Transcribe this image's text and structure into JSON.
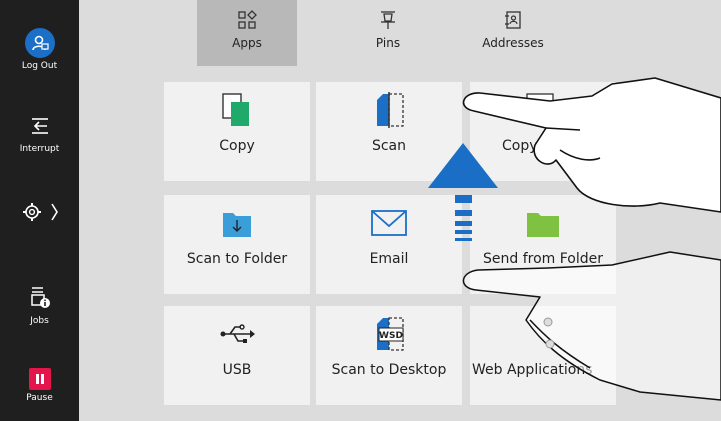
{
  "sidebar": {
    "logout_label": "Log Out",
    "interrupt_label": "Interrupt",
    "jobs_label": "Jobs",
    "pause_label": "Pause"
  },
  "tabs": [
    {
      "label": "Apps",
      "icon": "apps-icon"
    },
    {
      "label": "Pins",
      "icon": "pin-icon"
    },
    {
      "label": "Addresses",
      "icon": "address-book-icon"
    }
  ],
  "tiles": [
    {
      "label": "Copy",
      "icon": "copy-icon"
    },
    {
      "label": "Scan",
      "icon": "scan-icon"
    },
    {
      "label": "Copy",
      "icon": "id-card-copy-icon"
    },
    {
      "label": "Scan to Folder",
      "icon": "scan-to-folder-icon"
    },
    {
      "label": "Email",
      "icon": "envelope-icon"
    },
    {
      "label": "Send from Folder",
      "icon": "folder-icon"
    },
    {
      "label": "USB",
      "icon": "usb-icon"
    },
    {
      "label": "Scan to Desktop",
      "icon": "wsd-icon"
    },
    {
      "label": "Web Applications",
      "icon": "web-apps-icon"
    }
  ],
  "wsd_text": "WSD",
  "colors": {
    "accent_blue": "#1c6fc7",
    "green": "#1faa6b",
    "pause_red": "#e4154b",
    "sidebar": "#1f1f1f"
  }
}
